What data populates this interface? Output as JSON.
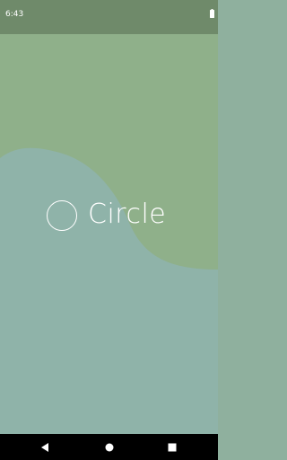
{
  "status_bar": {
    "time": "6:43",
    "battery_icon": "battery-full-icon",
    "background": "#6f8a6a"
  },
  "splash": {
    "app_name": "Circle",
    "logo_icon": "circle-outline-icon",
    "colors": {
      "top_blob": "#8fb08a",
      "bottom_blob": "#8fb3a9",
      "logo": "#ffffff"
    }
  },
  "nav_bar": {
    "back_icon": "back-triangle-icon",
    "home_icon": "home-circle-icon",
    "recents_icon": "recents-square-icon"
  }
}
